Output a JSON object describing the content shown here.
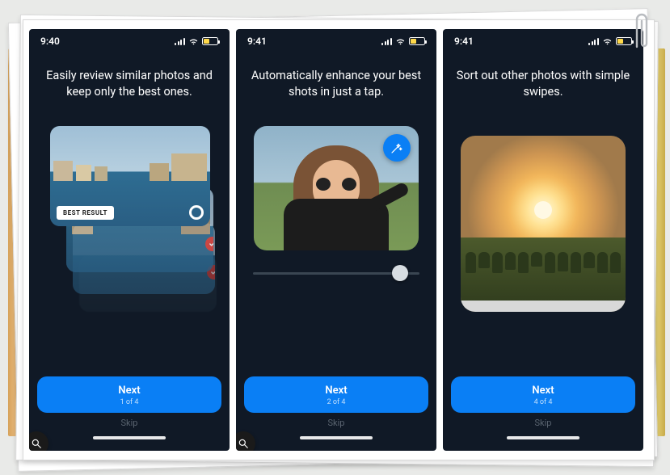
{
  "panels": [
    {
      "status_time": "9:40",
      "heading": "Easily review similar photos and keep only the best ones.",
      "best_label": "BEST RESULT",
      "next_label": "Next",
      "next_sub": "1 of 4",
      "skip_label": "Skip"
    },
    {
      "status_time": "9:41",
      "heading": "Automatically enhance your best shots in just a tap.",
      "next_label": "Next",
      "next_sub": "2 of 4",
      "skip_label": "Skip"
    },
    {
      "status_time": "9:41",
      "heading": "Sort out other photos with simple swipes.",
      "next_label": "Next",
      "next_sub": "4 of 4",
      "skip_label": "Skip"
    }
  ]
}
